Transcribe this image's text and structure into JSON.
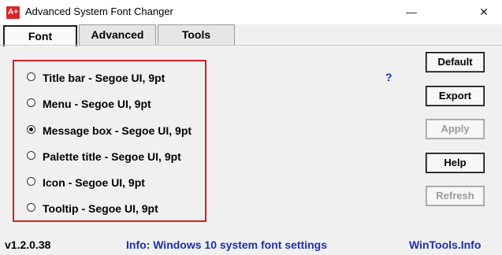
{
  "window": {
    "icon_text": "A+",
    "title": "Advanced System Font Changer",
    "minimize_glyph": "—",
    "close_glyph": "✕"
  },
  "tabs": [
    {
      "label": "Font",
      "active": true
    },
    {
      "label": "Advanced",
      "active": false
    },
    {
      "label": "Tools",
      "active": false
    }
  ],
  "font_options": [
    {
      "label": "Title bar - Segoe UI, 9pt",
      "checked": false
    },
    {
      "label": "Menu - Segoe UI, 9pt",
      "checked": false
    },
    {
      "label": "Message box - Segoe UI, 9pt",
      "checked": true
    },
    {
      "label": "Palette title - Segoe UI, 9pt",
      "checked": false
    },
    {
      "label": "Icon - Segoe UI, 9pt",
      "checked": false
    },
    {
      "label": "Tooltip - Segoe UI, 9pt",
      "checked": false
    }
  ],
  "help_mark": "?",
  "buttons": {
    "default": {
      "label": "Default",
      "enabled": true
    },
    "export": {
      "label": "Export",
      "enabled": true
    },
    "apply": {
      "label": "Apply",
      "enabled": false
    },
    "help": {
      "label": "Help",
      "enabled": true
    },
    "refresh": {
      "label": "Refresh",
      "enabled": false
    }
  },
  "footer": {
    "version": "v1.2.0.38",
    "info": "Info: Windows 10 system font settings",
    "link": "WinTools.Info"
  },
  "colors": {
    "highlight_box": "#d32027",
    "info_text": "#1c2fa8"
  }
}
